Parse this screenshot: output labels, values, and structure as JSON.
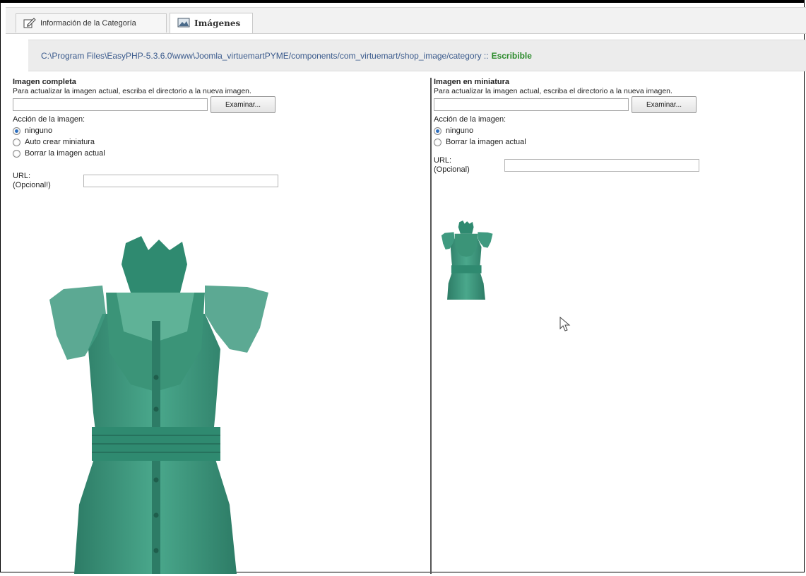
{
  "tabs": [
    {
      "label": "Información de la Categoría",
      "icon": "edit-icon",
      "active": false
    },
    {
      "label": "Imágenes",
      "icon": "image-icon",
      "active": true
    }
  ],
  "path": {
    "text": "C:\\Program Files\\EasyPHP-5.3.6.0\\www\\Joomla_virtuemartPYME/components/com_virtuemart/shop_image/category ::",
    "status": "Escribible",
    "status_color": "#2a8a2a"
  },
  "full_image": {
    "heading": "Imagen completa",
    "description": "Para actualizar la imagen actual, escriba el directorio a la nueva imagen.",
    "browse_label": "Examinar...",
    "action_label": "Acción de la imagen:",
    "options": [
      "ninguno",
      "Auto crear miniatura",
      "Borrar la imagen actual"
    ],
    "selected": "ninguno",
    "url_label": "URL:",
    "url_optional": "(Opcional!)",
    "url_value": ""
  },
  "thumb_image": {
    "heading": "Imagen en miniatura",
    "description": "Para actualizar la imagen actual, escriba el directorio a la nueva imagen.",
    "browse_label": "Examinar...",
    "action_label": "Acción de la imagen:",
    "options": [
      "ninguno",
      "Borrar la imagen actual"
    ],
    "selected": "ninguno",
    "url_label": "URL:",
    "url_optional": "(Opcional)",
    "url_value": ""
  },
  "colors": {
    "garment": "#3f9a80",
    "garment_dark": "#2d7c66",
    "radio_selected": "#2e6fbf"
  }
}
